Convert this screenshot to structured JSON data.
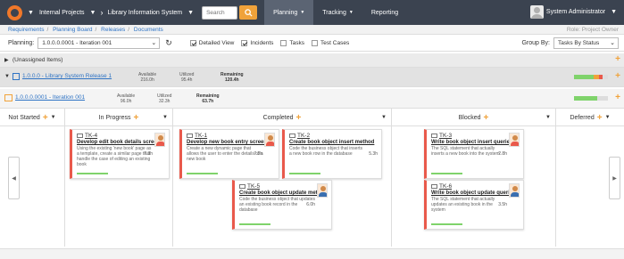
{
  "nav": {
    "project": "Internal Projects",
    "product": "Library Information System",
    "search_placeholder": "Search",
    "menus": [
      "Planning",
      "Tracking",
      "Reporting"
    ],
    "user": "System Administrator"
  },
  "breadcrumb": {
    "items": [
      "Requirements",
      "Planning Board",
      "Releases",
      "Documents"
    ],
    "role": "Role: Project Owner"
  },
  "filters": {
    "planning_label": "Planning:",
    "planning_value": "1.0.0.0.0001 - Iteration 001",
    "detailed_view": "Detailed View",
    "incidents": "Incidents",
    "tasks": "Tasks",
    "test_cases": "Test Cases",
    "group_by_label": "Group By:",
    "group_by_value": "Tasks By Status"
  },
  "rows": {
    "unassigned": "(Unassigned Items)",
    "release": {
      "name": "1.0.0.0 - Library System Release 1",
      "available_label": "Available",
      "available": "216.0h",
      "utilized_label": "Utilized",
      "utilized": "95.4h",
      "remaining_label": "Remaining",
      "remaining": "120.4h"
    },
    "iteration": {
      "name": "1.0.0.0.0001 - Iteration 001",
      "available_label": "Available",
      "available": "96.0h",
      "utilized_label": "Utilized",
      "utilized": "32.3h",
      "remaining_label": "Remaining",
      "remaining": "63.7h"
    }
  },
  "columns": [
    "Not Started",
    "In Progress",
    "Completed",
    "Blocked",
    "Deferred"
  ],
  "cards": [
    {
      "id": "TK-4",
      "title": "Develop edit book details screen",
      "desc": "Using the existing 'new book' page as a template, create a similar page that handle the case of editing an existing book",
      "est": "7.3h"
    },
    {
      "id": "TK-1",
      "title": "Develop new book entry screen",
      "desc": "Create a new dynamic page that allows the user to enter the details of a new book",
      "est": "7.3h"
    },
    {
      "id": "TK-2",
      "title": "Create book object insert method",
      "desc": "Code the business object that inserts a new book row in the database",
      "est": "5.3h"
    },
    {
      "id": "TK-5",
      "title": "Create book object update method",
      "desc": "Code the business object that updates an existing book record in the database",
      "est": "6.0h"
    },
    {
      "id": "TK-3",
      "title": "Write book object insert queries",
      "desc": "The SQL statement that actually inserts a new book into the system",
      "est": "2.8h"
    },
    {
      "id": "TK-6",
      "title": "Write book object update queries",
      "desc": "The SQL statement that actually updates an existing book in the system",
      "est": "3.5h"
    }
  ],
  "colors": {
    "topbar": "#3b4350",
    "accent": "#f0a23a",
    "link": "#2e73c4",
    "card_border": "#e9594b"
  }
}
